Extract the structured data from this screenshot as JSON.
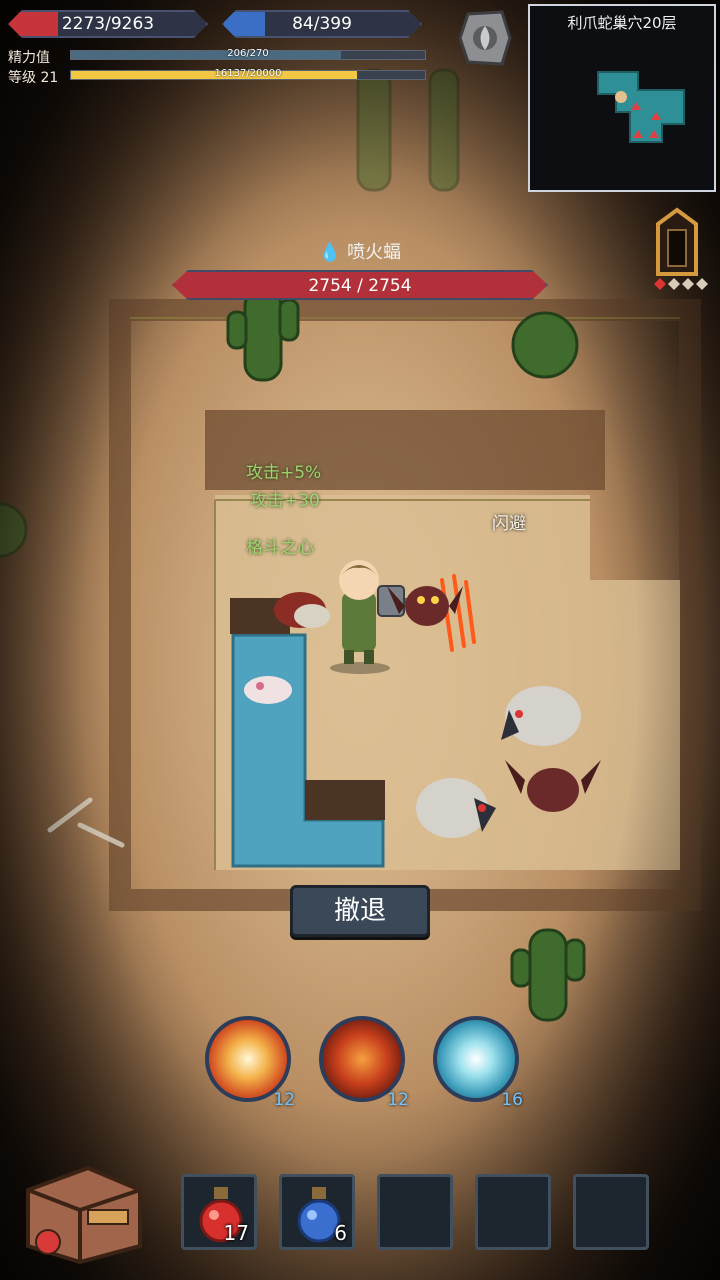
{
  "player": {
    "hp": "2273/9263",
    "hp_fraction": 0.245,
    "mp": "84/399",
    "mp_fraction": 0.21,
    "stamina_label": "精力值",
    "stamina_value": "206/270",
    "stamina_fraction": 0.763,
    "level_label": "等级 21",
    "xp_value": "16137/20000",
    "xp_fraction": 0.807
  },
  "minimap": {
    "title": "利爪蛇巢穴20层"
  },
  "boss": {
    "name": "喷火蝠",
    "hp": "2754 / 2754",
    "hp_fraction": 1.0
  },
  "combat_text": {
    "buff1": "攻击+5%",
    "buff2": "攻击+30",
    "buff3": "格斗之心",
    "dodge": "闪避"
  },
  "actions": {
    "retreat_label": "撤退"
  },
  "skills": [
    {
      "icon": "explosion-icon",
      "count": "12"
    },
    {
      "icon": "fire-vortex-icon",
      "count": "12"
    },
    {
      "icon": "ice-burst-icon",
      "count": "16"
    }
  ],
  "items": [
    {
      "icon": "red-potion-icon",
      "count": "17"
    },
    {
      "icon": "blue-potion-icon",
      "count": "6"
    },
    {
      "icon": "",
      "count": ""
    },
    {
      "icon": "",
      "count": ""
    },
    {
      "icon": "",
      "count": ""
    }
  ],
  "colors": {
    "hp": "#c8343c",
    "mp": "#3b6fc6",
    "stamina": "#4a6a80",
    "xp": "#f2c744",
    "boss_hp": "#b1303a",
    "buff_text": "#9fd26e",
    "skill_count": "#6fc4ff"
  }
}
